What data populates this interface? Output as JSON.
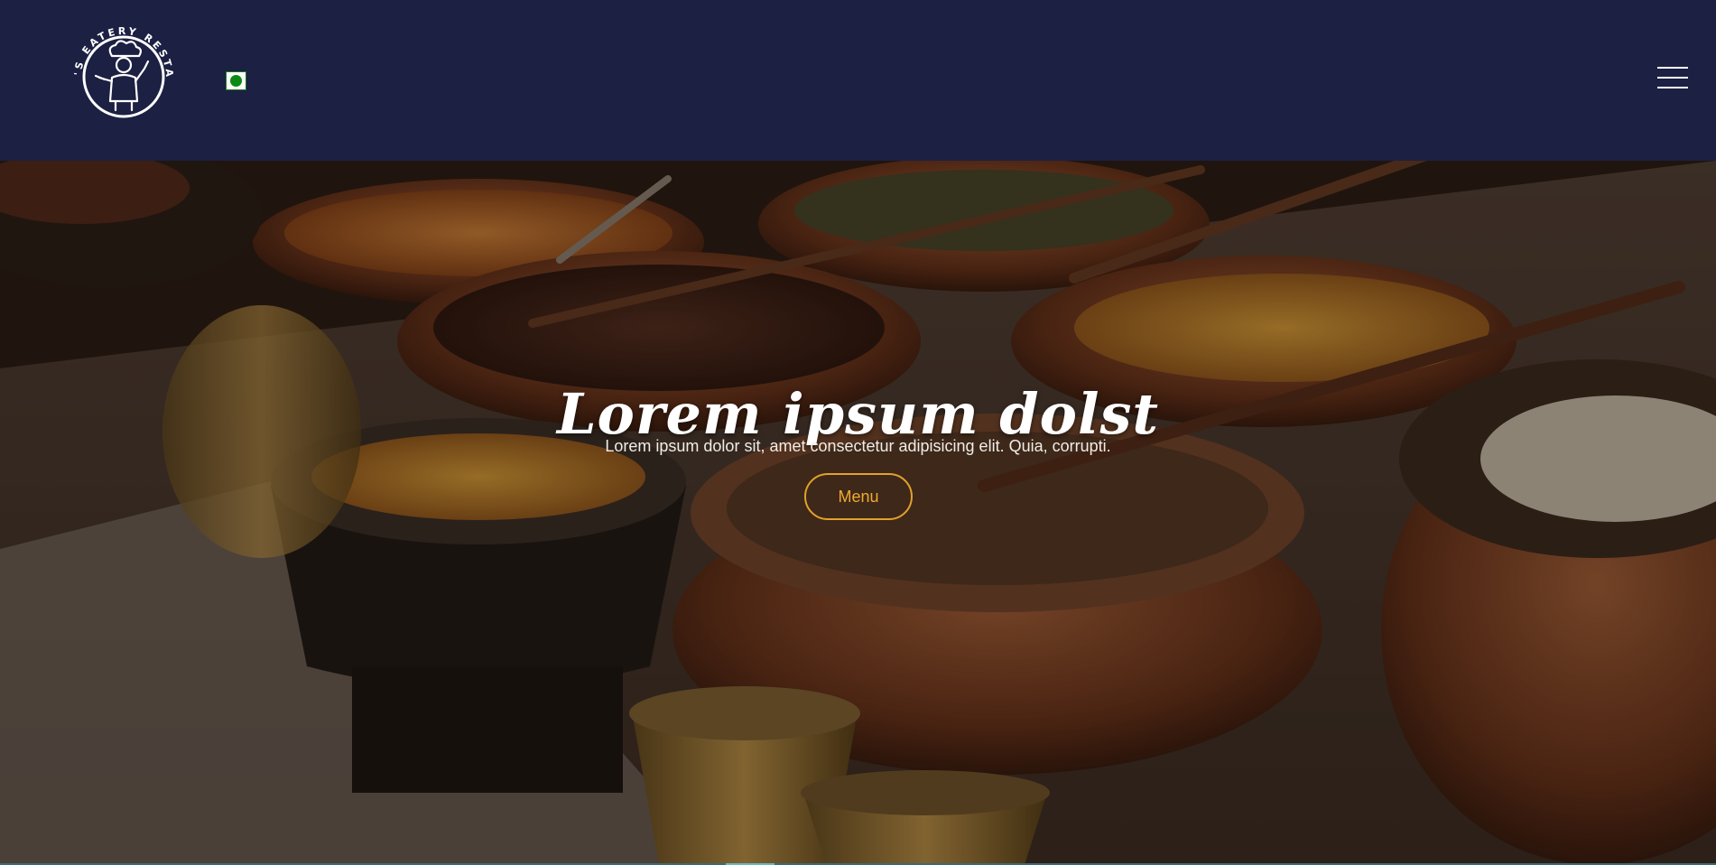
{
  "brand": {
    "logo_ring_text": "MANAN'S EATERY RESTAURANT",
    "logo_icon": "chef-icon"
  },
  "header": {
    "veg_badge_icon": "veg-symbol-icon",
    "menu_toggle_icon": "hamburger-icon"
  },
  "hero": {
    "title": "Lorem ipsum dolst",
    "subtitle": "Lorem ipsum dolor sit, amet consectetur adipisicing elit. Quia, corrupti.",
    "button_label": "Menu",
    "background_image": "indian-food-copper-pots-photo"
  },
  "colors": {
    "header_bg": "#1c2042",
    "accent": "#e3a12a",
    "veg_green": "#0a8a12",
    "text_light": "#ffffff"
  }
}
